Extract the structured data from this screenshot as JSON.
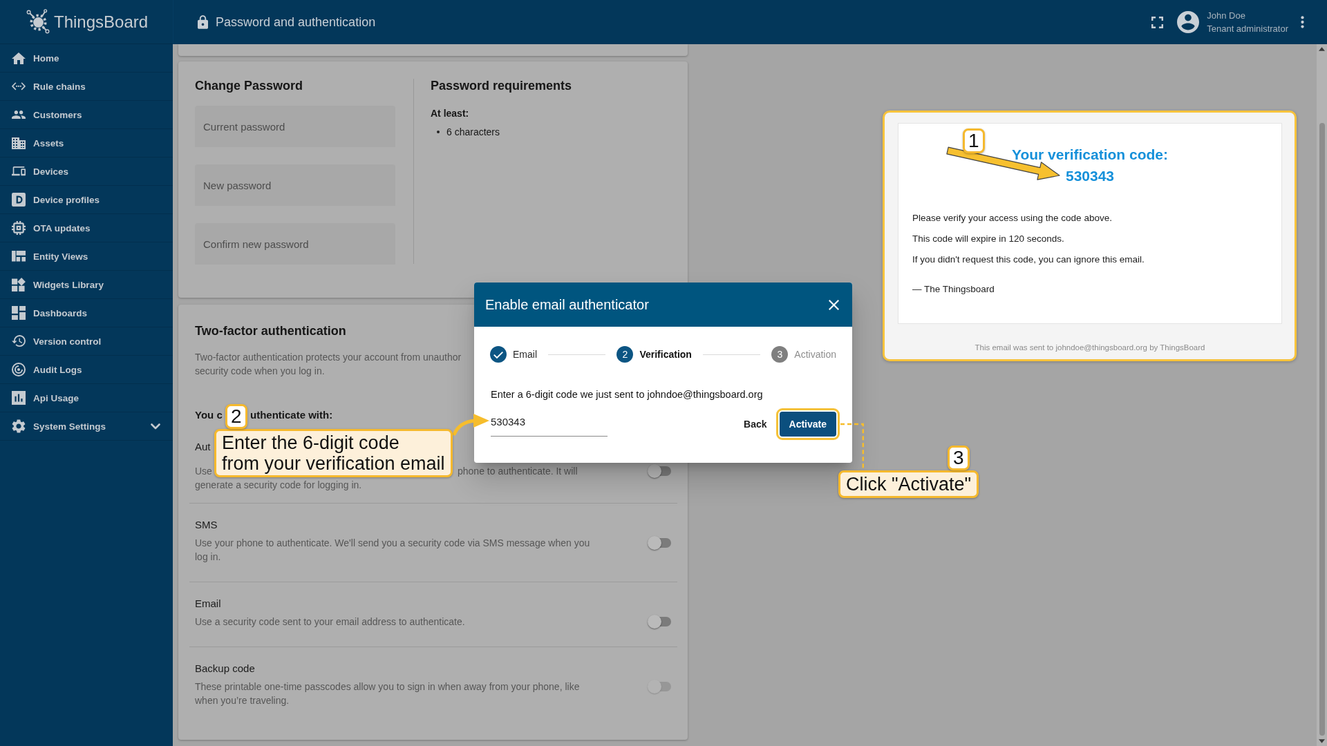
{
  "sidebar": {
    "logo": "ThingsBoard",
    "items": [
      {
        "label": "Home",
        "kind": "link",
        "selected": false
      },
      {
        "label": "Rule chains",
        "kind": "link",
        "selected": false
      },
      {
        "label": "Customers",
        "kind": "link",
        "selected": false
      },
      {
        "label": "Assets",
        "kind": "link",
        "selected": false
      },
      {
        "label": "Devices",
        "kind": "link",
        "selected": false
      },
      {
        "label": "Device profiles",
        "kind": "link",
        "selected": false
      },
      {
        "label": "OTA updates",
        "kind": "link",
        "selected": false
      },
      {
        "label": "Entity Views",
        "kind": "link",
        "selected": false
      },
      {
        "label": "Widgets Library",
        "kind": "link",
        "selected": false
      },
      {
        "label": "Dashboards",
        "kind": "link",
        "selected": false
      },
      {
        "label": "Version control",
        "kind": "link",
        "selected": false
      },
      {
        "label": "Audit Logs",
        "kind": "link",
        "selected": false
      },
      {
        "label": "Api Usage",
        "kind": "link",
        "selected": false
      },
      {
        "label": "System Settings",
        "kind": "group",
        "selected": false,
        "expanded": false
      }
    ]
  },
  "header": {
    "title": "Password and authentication",
    "user": {
      "name": "John Doe",
      "role": "Tenant administrator"
    }
  },
  "change_password": {
    "title": "Change Password",
    "fields": [
      {
        "placeholder": "Current password"
      },
      {
        "placeholder": "New password"
      },
      {
        "placeholder": "Confirm new password"
      }
    ]
  },
  "password_requirements": {
    "title": "Password requirements",
    "subtitle": "At least:",
    "items": [
      "6 characters"
    ]
  },
  "two_factor": {
    "title": "Two-factor authentication",
    "description_parts": [
      "Two-factor authentication protects your account from unauthor",
      "security code when you log in."
    ],
    "methods_heading_parts": [
      "You c",
      "uthenticate with:"
    ],
    "methods": [
      {
        "title": "Aut",
        "description_parts": [
          "Use",
          "phone to authenticate. It will",
          "generate a security code for logging in."
        ],
        "on": false,
        "disabled": false
      },
      {
        "title": "SMS",
        "description": "Use your phone to authenticate. We'll send you a security code via SMS message when you log in.",
        "on": false,
        "disabled": false
      },
      {
        "title": "Email",
        "description": "Use a security code sent to your email address to authenticate.",
        "on": false,
        "disabled": false
      },
      {
        "title": "Backup code",
        "description": "These printable one-time passcodes allow you to sign in when away from your phone, like when you’re traveling.",
        "on": false,
        "disabled": true
      }
    ]
  },
  "dialog": {
    "title": "Enable email authenticator",
    "steps": [
      {
        "label": "Email",
        "completed": true,
        "selected": false
      },
      {
        "label": "Verification",
        "number": "2",
        "completed": false,
        "selected": true
      },
      {
        "label": "Activation",
        "number": "3",
        "completed": false,
        "selected": false
      }
    ],
    "instruction": "Enter a 6-digit code we just sent to johndoe@thingsboard.org",
    "code_field": {
      "value": "530343"
    },
    "buttons": [
      {
        "label": "Back",
        "kind": "text"
      },
      {
        "label": "Activate",
        "kind": "primary"
      }
    ]
  },
  "email_preview": {
    "heading": "Your verification code:",
    "code": "530343",
    "paragraphs": [
      "Please verify your access using the code above.",
      "This code will expire in 120 seconds.",
      "If you didn't request this code, you can ignore this email."
    ],
    "signature": "— The Thingsboard",
    "footer": "This email was sent to johndoe@thingsboard.org by ThingsBoard"
  },
  "annotations": [
    {
      "number": "1"
    },
    {
      "number": "2",
      "text": "Enter the 6-digit code\nfrom your verification email"
    },
    {
      "number": "3",
      "text": "Click \"Activate\""
    }
  ]
}
